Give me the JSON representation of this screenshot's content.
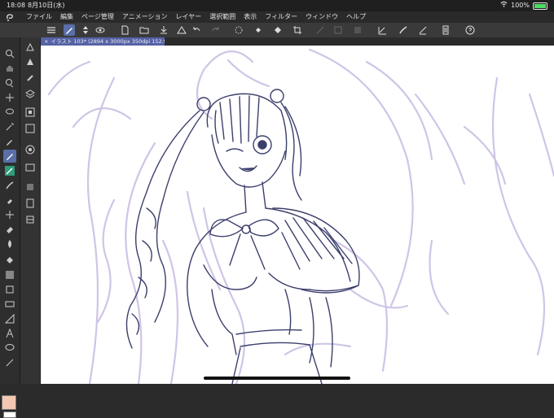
{
  "status": {
    "time": "18:08",
    "date": "8月10日(水)",
    "battery": "100%"
  },
  "menu": {
    "items": [
      "ファイル",
      "編集",
      "ページ管理",
      "アニメーション",
      "レイヤー",
      "選択範囲",
      "表示",
      "フィルター",
      "ウィンドウ",
      "ヘルプ"
    ]
  },
  "toolbar": {
    "icons": [
      "menu-icon",
      "pen-tool-icon",
      "swap-icon",
      "eye-icon",
      "new-file-icon",
      "open-folder-icon",
      "save-icon",
      "triangle-up-icon",
      "undo-icon",
      "redo-icon",
      "marquee-icon",
      "fill-icon",
      "crop-icon",
      "select-all-icon",
      "deselect-icon",
      "invert-icon",
      "pen-angle-icon",
      "brush-icon",
      "brush-alt-icon",
      "layer-icon",
      "help-icon"
    ]
  },
  "document_tab": {
    "title": "イラスト 103* (2894 x 3000px 350dpi 152.9%)",
    "close": "×"
  },
  "colors": {
    "accent": "#5a6fa8",
    "tab": "#5562a6",
    "sketch_primary": "#3b3f6b",
    "sketch_guide": "#c9bfe0",
    "main_color": "#f3c8b2"
  }
}
